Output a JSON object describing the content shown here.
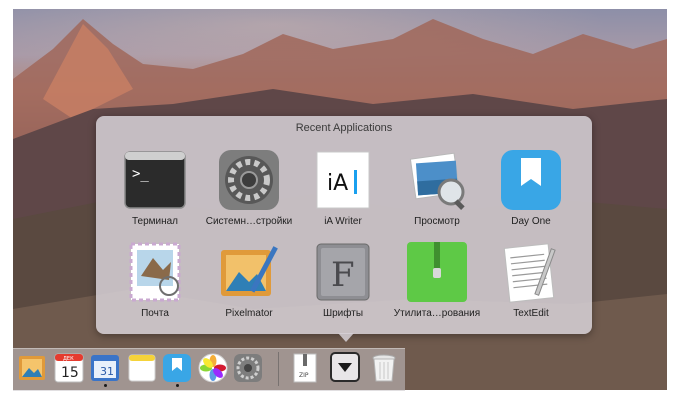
{
  "popup": {
    "title": "Recent Applications",
    "apps": [
      {
        "label": "Терминал",
        "icon": "terminal-icon"
      },
      {
        "label": "Системн…стройки",
        "icon": "system-preferences-icon"
      },
      {
        "label": "iA Writer",
        "icon": "ia-writer-icon",
        "icon_text": "iA"
      },
      {
        "label": "Просмотр",
        "icon": "preview-icon"
      },
      {
        "label": "Day One",
        "icon": "day-one-icon"
      },
      {
        "label": "Почта",
        "icon": "mail-icon"
      },
      {
        "label": "Pixelmator",
        "icon": "pixelmator-icon"
      },
      {
        "label": "Шрифты",
        "icon": "font-book-icon",
        "icon_text": "F"
      },
      {
        "label": "Утилита…рования",
        "icon": "archive-utility-icon"
      },
      {
        "label": "TextEdit",
        "icon": "textedit-icon"
      }
    ]
  },
  "dock": {
    "items": [
      {
        "icon": "photo-viewer-icon"
      },
      {
        "icon": "calendar-icon",
        "text": "15",
        "month": "ДЕК"
      },
      {
        "icon": "calendar-blue-icon",
        "text": "31"
      },
      {
        "icon": "notes-icon"
      },
      {
        "icon": "day-one-icon"
      },
      {
        "icon": "photos-icon"
      },
      {
        "icon": "system-preferences-icon"
      },
      {
        "icon": "zip-file-icon",
        "text": "ZIP"
      },
      {
        "icon": "stack-down-arrow-icon"
      },
      {
        "icon": "trash-icon"
      }
    ]
  }
}
